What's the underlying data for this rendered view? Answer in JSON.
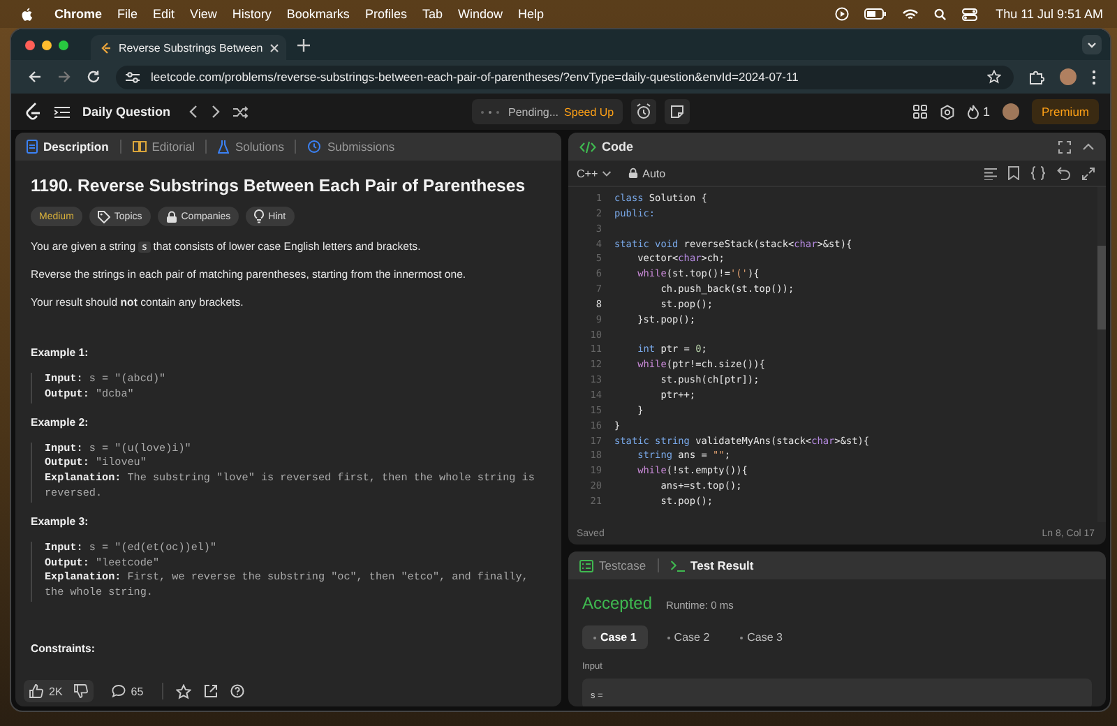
{
  "menu_bar": {
    "app": "Chrome",
    "items": [
      "File",
      "Edit",
      "View",
      "History",
      "Bookmarks",
      "Profiles",
      "Tab",
      "Window",
      "Help"
    ],
    "clock": "Thu 11 Jul  9:51 AM"
  },
  "browser": {
    "tab_title": "Reverse Substrings Between",
    "url": "leetcode.com/problems/reverse-substrings-between-each-pair-of-parentheses/?envType=daily-question&envId=2024-07-11"
  },
  "app_bar": {
    "title": "Daily Question",
    "pending": "Pending...",
    "speed_up": "Speed Up",
    "streak": "1",
    "premium": "Premium"
  },
  "left_tabs": [
    {
      "label": "Description",
      "selected": true
    },
    {
      "label": "Editorial",
      "selected": false
    },
    {
      "label": "Solutions",
      "selected": false
    },
    {
      "label": "Submissions",
      "selected": false
    }
  ],
  "problem": {
    "title": "1190. Reverse Substrings Between Each Pair of Parentheses",
    "tags": [
      {
        "label": "Medium",
        "kind": "difficulty",
        "color": "#d9b13b"
      },
      {
        "label": "Topics",
        "kind": "topics"
      },
      {
        "label": "Companies",
        "kind": "companies"
      },
      {
        "label": "Hint",
        "kind": "hint"
      }
    ],
    "intro": {
      "before": "You are given a string",
      "code": "s",
      "after": "that consists of lower case English letters and brackets."
    },
    "paragraphs": [
      "Reverse the strings in each pair of matching parentheses, starting from the innermost one.",
      "Your result should **not** contain any brackets."
    ],
    "examples": [
      {
        "title": "Example 1:",
        "lines": [
          {
            "label": "Input:",
            "value": "s = \"(abcd)\""
          },
          {
            "label": "Output:",
            "value": "\"dcba\""
          }
        ]
      },
      {
        "title": "Example 2:",
        "lines": [
          {
            "label": "Input:",
            "value": "s = \"(u(love)i)\""
          },
          {
            "label": "Output:",
            "value": "\"iloveu\""
          },
          {
            "label": "Explanation:",
            "value": "The substring \"love\" is reversed first, then the whole string is reversed."
          }
        ]
      },
      {
        "title": "Example 3:",
        "lines": [
          {
            "label": "Input:",
            "value": "s = \"(ed(et(oc))el)\""
          },
          {
            "label": "Output:",
            "value": "\"leetcode\""
          },
          {
            "label": "Explanation:",
            "value": "First, we reverse the substring \"oc\", then \"etco\", and finally, the whole string."
          }
        ]
      }
    ],
    "constraints_title": "Constraints:"
  },
  "footer": {
    "likes": "2K",
    "comments": "65"
  },
  "code_panel": {
    "title": "Code",
    "language": "C++",
    "mode": "Auto",
    "status": "Saved",
    "cursor": "Ln 8, Col 17",
    "lines": [
      {
        "n": "1",
        "current": false,
        "tokens": [
          {
            "text": "class",
            "kind": "kw"
          },
          {
            "text": " Solution {",
            "kind": "plain"
          }
        ]
      },
      {
        "n": "2",
        "current": false,
        "tokens": [
          {
            "text": "public:",
            "kind": "kw"
          }
        ]
      },
      {
        "n": "3",
        "current": false
      },
      {
        "n": "4",
        "current": false,
        "tokens": [
          {
            "text": "static void",
            "kind": "kw"
          },
          {
            "text": " reverseStack(stack<",
            "kind": "plain"
          },
          {
            "text": "char",
            "kind": "ty"
          },
          {
            "text": ">&st){",
            "kind": "plain"
          }
        ]
      },
      {
        "n": "5",
        "current": false,
        "tokens": [
          {
            "text": "    vector<",
            "kind": "plain"
          },
          {
            "text": "char",
            "kind": "ty"
          },
          {
            "text": ">ch;",
            "kind": "plain"
          }
        ]
      },
      {
        "n": "6",
        "current": false,
        "tokens": [
          {
            "text": "    while",
            "kind": "ctl"
          },
          {
            "text": "(st.top()!=",
            "kind": "plain"
          },
          {
            "text": "'('",
            "kind": "str"
          },
          {
            "text": "){",
            "kind": "plain"
          }
        ]
      },
      {
        "n": "7",
        "current": false,
        "tokens": [
          {
            "text": "        ch.push_back(st.top());",
            "kind": "plain"
          }
        ]
      },
      {
        "n": "8",
        "current": true,
        "tokens": [
          {
            "text": "        st.pop();",
            "kind": "plain"
          }
        ]
      },
      {
        "n": "9",
        "current": false,
        "tokens": [
          {
            "text": "    }st.pop();",
            "kind": "plain"
          }
        ]
      },
      {
        "n": "10",
        "current": false
      },
      {
        "n": "11",
        "current": false,
        "tokens": [
          {
            "text": "    int",
            "kind": "kw"
          },
          {
            "text": " ptr = ",
            "kind": "plain"
          },
          {
            "text": "0",
            "kind": "num"
          },
          {
            "text": ";",
            "kind": "plain"
          }
        ]
      },
      {
        "n": "12",
        "current": false,
        "tokens": [
          {
            "text": "    while",
            "kind": "ctl"
          },
          {
            "text": "(ptr!=ch.size()){",
            "kind": "plain"
          }
        ]
      },
      {
        "n": "13",
        "current": false,
        "tokens": [
          {
            "text": "        st.push(ch[ptr]);",
            "kind": "plain"
          }
        ]
      },
      {
        "n": "14",
        "current": false,
        "tokens": [
          {
            "text": "        ptr++;",
            "kind": "plain"
          }
        ]
      },
      {
        "n": "15",
        "current": false,
        "tokens": [
          {
            "text": "    }",
            "kind": "plain"
          }
        ]
      },
      {
        "n": "16",
        "current": false,
        "tokens": [
          {
            "text": "}",
            "kind": "plain"
          }
        ]
      },
      {
        "n": "17",
        "current": false,
        "tokens": [
          {
            "text": "static string",
            "kind": "kw"
          },
          {
            "text": " validateMyAns(stack<",
            "kind": "plain"
          },
          {
            "text": "char",
            "kind": "ty"
          },
          {
            "text": ">&st){",
            "kind": "plain"
          }
        ]
      },
      {
        "n": "18",
        "current": false,
        "tokens": [
          {
            "text": "    string",
            "kind": "kw"
          },
          {
            "text": " ans = ",
            "kind": "plain"
          },
          {
            "text": "\"\"",
            "kind": "str"
          },
          {
            "text": ";",
            "kind": "plain"
          }
        ]
      },
      {
        "n": "19",
        "current": false,
        "tokens": [
          {
            "text": "    while",
            "kind": "ctl"
          },
          {
            "text": "(!st.empty()){",
            "kind": "plain"
          }
        ]
      },
      {
        "n": "20",
        "current": false,
        "tokens": [
          {
            "text": "        ans+=st.top();",
            "kind": "plain"
          }
        ]
      },
      {
        "n": "21",
        "current": false,
        "tokens": [
          {
            "text": "        st.pop();",
            "kind": "plain"
          }
        ]
      }
    ]
  },
  "result_tabs": [
    {
      "label": "Testcase",
      "selected": false
    },
    {
      "label": "Test Result",
      "selected": true
    }
  ],
  "result": {
    "verdict": "Accepted",
    "runtime": "Runtime: 0 ms",
    "cases": [
      {
        "label": "Case 1",
        "selected": true
      },
      {
        "label": "Case 2",
        "selected": false
      },
      {
        "label": "Case 3",
        "selected": false
      }
    ],
    "input_label": "Input",
    "input_value": "s ="
  }
}
